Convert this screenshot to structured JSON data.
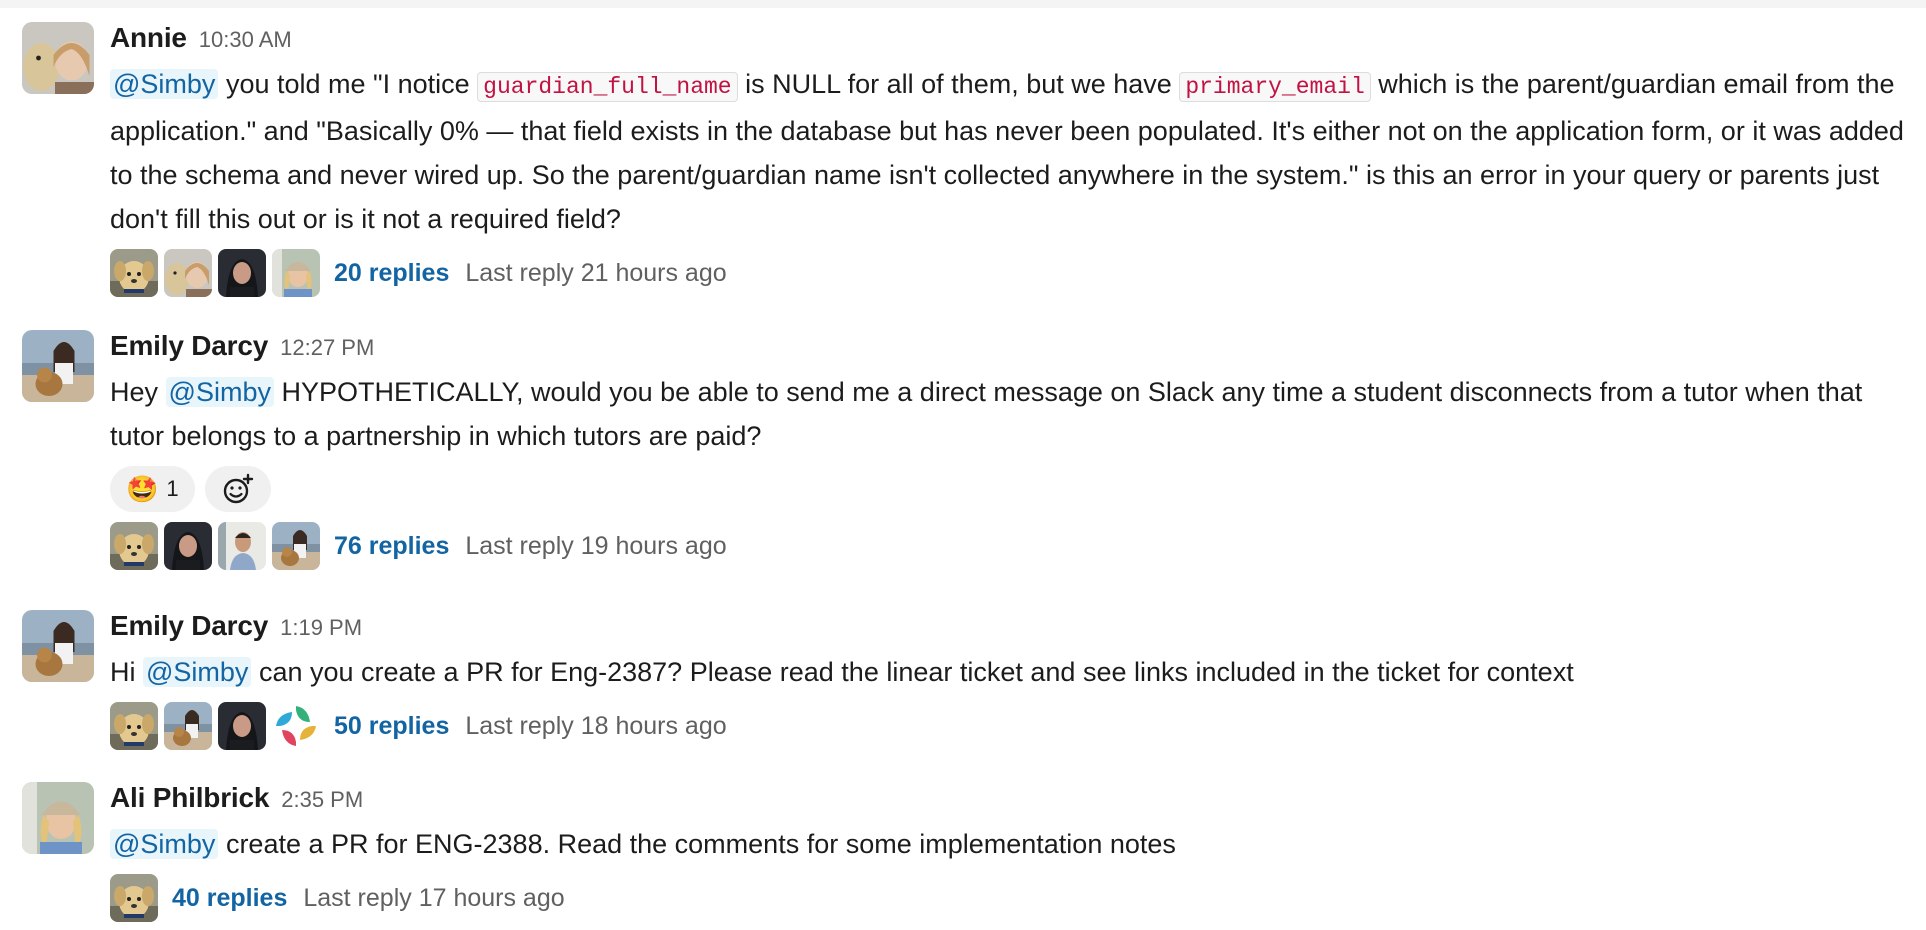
{
  "messages": [
    {
      "author": "Annie",
      "time": "10:30 AM",
      "mention": "@Simby",
      "text_1": " you told me \"I notice ",
      "code_1": "guardian_full_name",
      "text_2": " is NULL for all of them, but we have ",
      "code_2": "primary_email",
      "text_3": " which is the parent/guardian email from the application.\" and \"Basically 0% — that field exists in the database but has never been populated. It's either not on the application form, or it was added to the schema and never wired up. So the parent/guardian name isn't collected anywhere in the system.\" is this an error in your query or parents just don't fill this out or is it not a required field?",
      "replies": "20 replies",
      "last_reply": "Last reply 21 hours ago"
    },
    {
      "author": "Emily Darcy",
      "time": "12:27 PM",
      "text_pre": "Hey ",
      "mention": "@Simby",
      "text_1": " HYPOTHETICALLY, would you be able to send me a direct message on Slack any time a student disconnects from a tutor when that tutor belongs to a partnership in which tutors are paid?",
      "reaction_emoji": "🤩",
      "reaction_count": "1",
      "replies": "76 replies",
      "last_reply": "Last reply 19 hours ago"
    },
    {
      "author": "Emily Darcy",
      "time": "1:19 PM",
      "text_pre": "Hi ",
      "mention": "@Simby",
      "text_1": " can you create a PR for Eng-2387? Please read the linear ticket and see links included in the ticket for context",
      "replies": "50 replies",
      "last_reply": "Last reply 18 hours ago"
    },
    {
      "author": "Ali Philbrick",
      "time": "2:35 PM",
      "mention": "@Simby",
      "text_1": " create a PR for ENG-2388. Read the comments for some implementation notes",
      "replies": "40 replies",
      "last_reply": "Last reply 17 hours ago"
    }
  ],
  "icons": {
    "add_reaction": "add-reaction-icon"
  },
  "colors": {
    "link": "#1264a3",
    "mention_bg": "#e8f5fa",
    "code_text": "#c01343",
    "muted": "#616061"
  }
}
